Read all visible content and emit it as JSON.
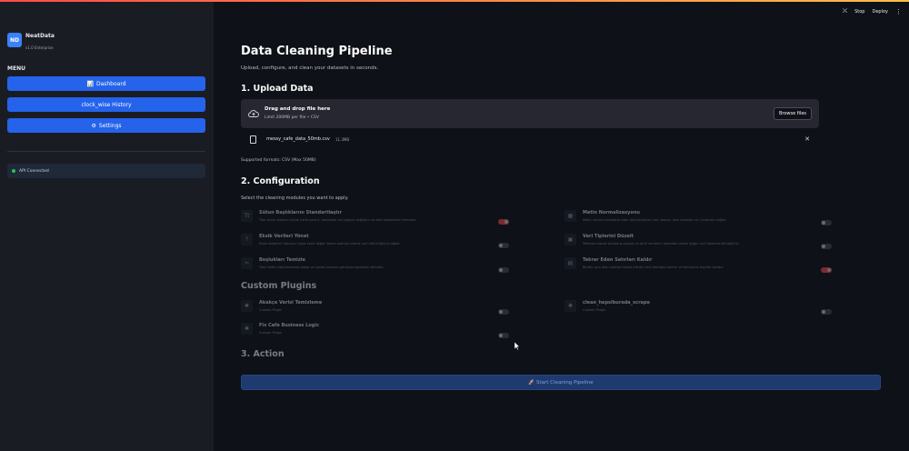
{
  "app": {
    "logo_text": "ND",
    "name": "NeatData",
    "version": "v1.0 Enterprise"
  },
  "sidebar": {
    "menu_title": "MENU",
    "items": [
      {
        "icon": "📊",
        "label": "Dashboard"
      },
      {
        "icon": "",
        "label": "clock_wise History"
      },
      {
        "icon": "⚙",
        "label": "Settings"
      }
    ],
    "api_status": "API Connected"
  },
  "header": {
    "stop": "Stop",
    "deploy": "Deploy",
    "menu_glyph": "⋮"
  },
  "page": {
    "title": "Data Cleaning Pipeline",
    "subtitle": "Upload, configure, and clean your datasets in seconds."
  },
  "upload": {
    "heading": "1. Upload Data",
    "drag_title": "Drag and drop file here",
    "limit": "Limit 200MB per file • CSV",
    "browse_label": "Browse files",
    "file_name": "messy_cafe_data_50mb.csv",
    "file_size": "11.3MB",
    "supported": "Supported formats: CSV (Max 50MB)"
  },
  "config": {
    "heading": "2. Configuration",
    "subtitle": "Select the cleaning modules you want to apply.",
    "modules": [
      {
        "icon": "Tt",
        "title": "Sütun Başlıklarını Standartlaştır",
        "desc": "Tüm sütun adlarını küçük harfe çevirir, boşlukları alt çizgiyle değiştirir ve özel karakterleri temizler.",
        "enabled": true
      },
      {
        "icon": "▦",
        "title": "Metin Normalizasyonu",
        "desc": "Metin verileri normalize eder (büyük/küçük harf, boşluk, özel karakter vb.) tutarlılık sağlar.",
        "enabled": false
      },
      {
        "icon": "?",
        "title": "Eksik Verileri Yönet",
        "desc": "Eksik değerleri doldurur veya eksik değer içeren satırları silerek veri bütünlüğünü sağlar.",
        "enabled": false
      },
      {
        "icon": "▣",
        "title": "Veri Tiplerini Düzelt",
        "desc": "Metinsel olarak tutulmuş sayısal ve tarih verilerini otomatik olarak doğru veri tiplerine dönüştürür.",
        "enabled": false
      },
      {
        "icon": "✂",
        "title": "Boşlukları Temizle",
        "desc": "Tüm metin sütunlarındaki başta ve sonda bulunan gereksiz boşlukları temizler.",
        "enabled": false
      },
      {
        "icon": "▤",
        "title": "Tekrar Eden Satırları Kaldır",
        "desc": "Birebir aynı olan satırları tespit ederek veri setinden kaldırır ve benzersiz kayıtlar bırakır.",
        "enabled": true
      }
    ]
  },
  "plugins": {
    "heading": "Custom Plugins",
    "items": [
      {
        "icon": "✱",
        "title": "Akakçe Verisi Temizleme",
        "desc": "Custom Plugin",
        "enabled": false
      },
      {
        "icon": "✱",
        "title": "clean_hepsiburada_scrape",
        "desc": "Custom Plugin",
        "enabled": false
      },
      {
        "icon": "✱",
        "title": "Fix Cafe Business Logic",
        "desc": "Custom Plugin",
        "enabled": false
      }
    ]
  },
  "action": {
    "heading": "3. Action",
    "button": "🚀 Start Cleaning Pipeline"
  }
}
